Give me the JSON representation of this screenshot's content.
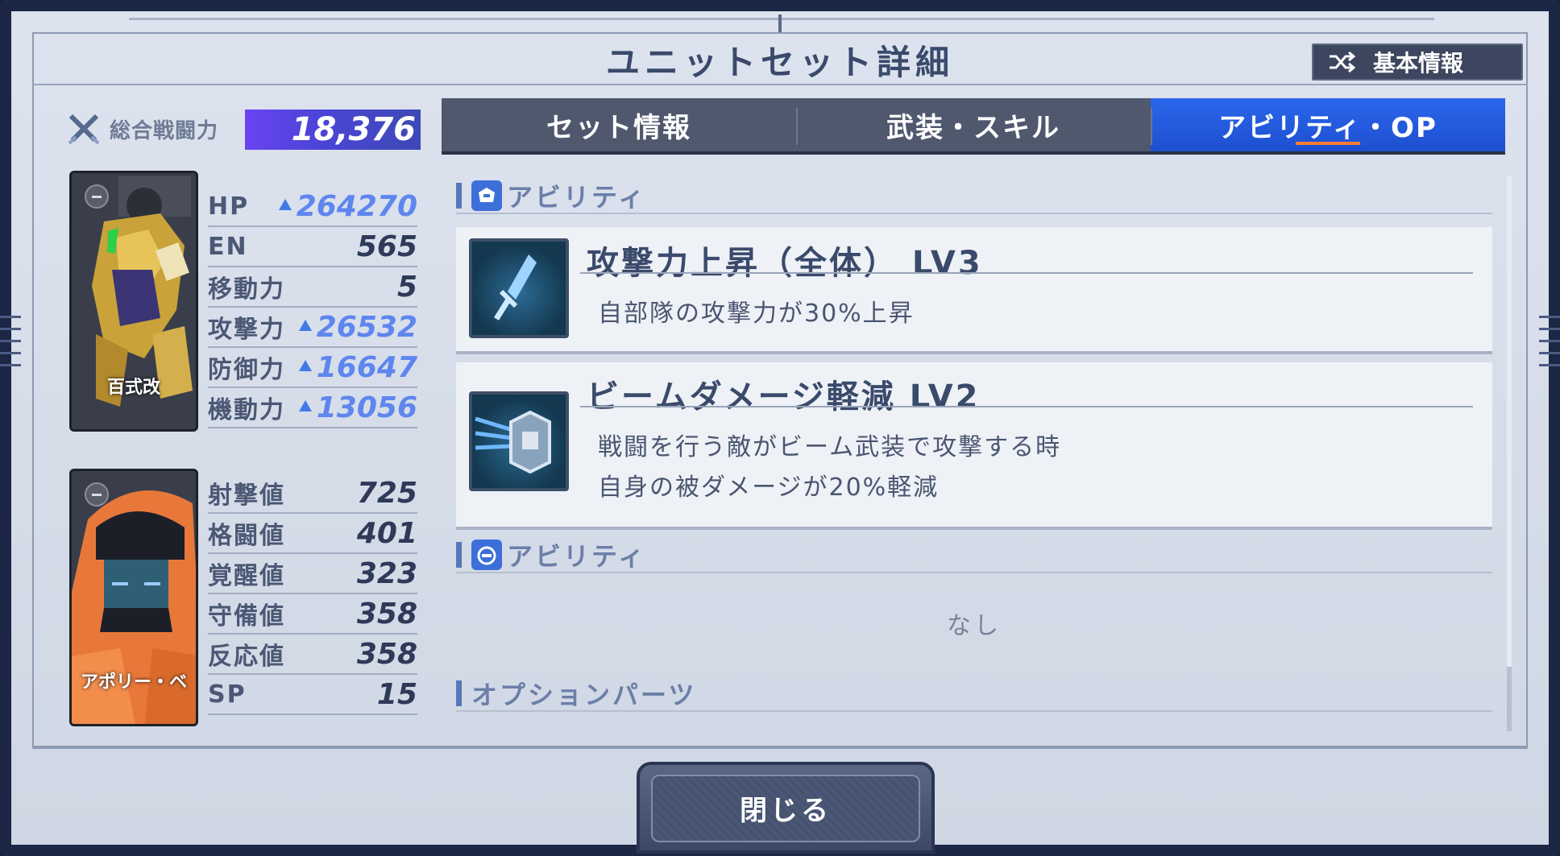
{
  "window": {
    "title": "ユニットセット詳細"
  },
  "basic_info_button": {
    "label": "基本情報",
    "icon": "shuffle-icon"
  },
  "combat_power": {
    "label": "総合戦闘力",
    "value": "18,376",
    "icon": "crossed-swords-icon"
  },
  "unit": {
    "name": "百式改",
    "stats": [
      {
        "key": "HP",
        "value": "264270",
        "boosted": true
      },
      {
        "key": "EN",
        "value": "565",
        "boosted": false
      },
      {
        "key": "移動力",
        "value": "5",
        "boosted": false
      },
      {
        "key": "攻撃力",
        "value": "26532",
        "boosted": true
      },
      {
        "key": "防御力",
        "value": "16647",
        "boosted": true
      },
      {
        "key": "機動力",
        "value": "13056",
        "boosted": true
      }
    ]
  },
  "pilot": {
    "name": "アポリー・ベ",
    "stats": [
      {
        "key": "射撃値",
        "value": "725"
      },
      {
        "key": "格闘値",
        "value": "401"
      },
      {
        "key": "覚醒値",
        "value": "323"
      },
      {
        "key": "守備値",
        "value": "358"
      },
      {
        "key": "反応値",
        "value": "358"
      },
      {
        "key": "SP",
        "value": "15"
      }
    ]
  },
  "tabs": [
    {
      "label": "セット情報",
      "active": false
    },
    {
      "label": "武装・スキル",
      "active": false
    },
    {
      "label": "アビリティ・OP",
      "active": true
    }
  ],
  "unit_abilities": {
    "heading": "アビリティ",
    "items": [
      {
        "title": "攻撃力上昇（全体） LV3",
        "desc": [
          "自部隊の攻撃力が30%上昇"
        ],
        "icon": "sword-icon"
      },
      {
        "title": "ビームダメージ軽減 LV2",
        "desc": [
          "戦闘を行う敵がビーム武装で攻撃する時",
          "自身の被ダメージが20%軽減"
        ],
        "icon": "beam-shield-icon"
      }
    ]
  },
  "pilot_abilities": {
    "heading": "アビリティ",
    "empty_text": "なし"
  },
  "option_parts": {
    "heading": "オプションパーツ"
  },
  "close_button": {
    "label": "閉じる"
  },
  "colors": {
    "active_tab": "#1e4fd0",
    "boosted_value": "#5e86ee",
    "tab_underline": "#ff7a3a",
    "combat_power_bar": "#6a44f0"
  }
}
